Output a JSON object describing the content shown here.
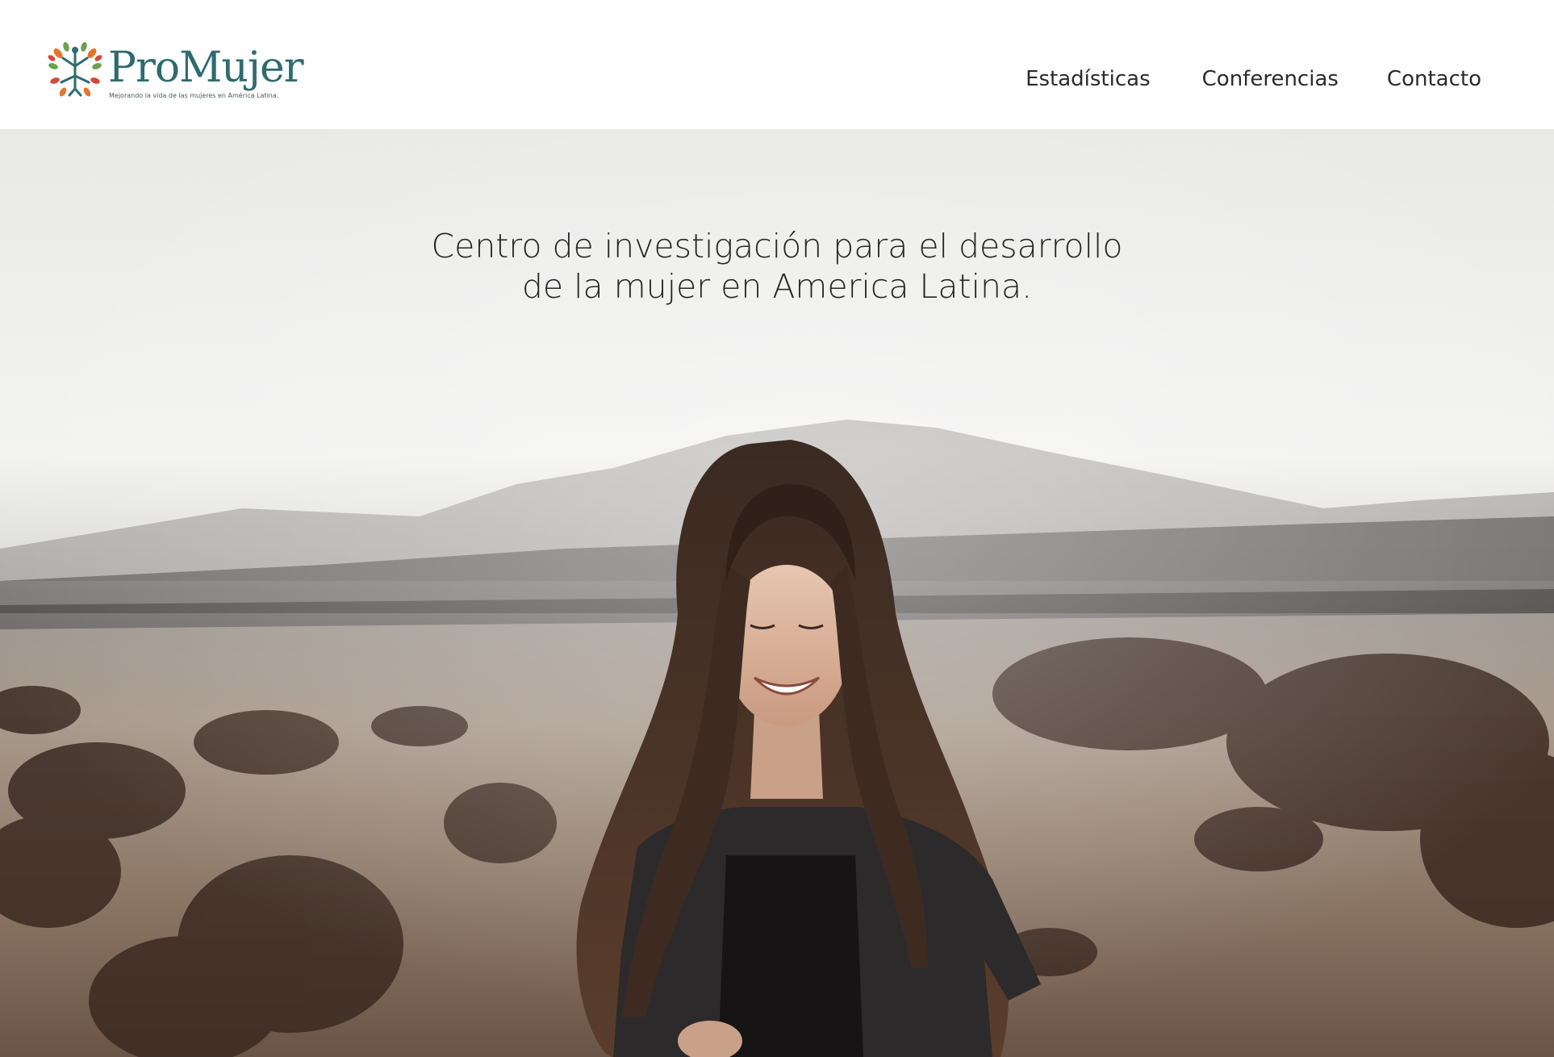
{
  "brand": {
    "name": "ProMujer",
    "tagline": "Mejorando la vida de las mujeres en América Latina.",
    "logo_icon": "tree-people-icon",
    "colors": {
      "text": "#2f6b6f",
      "leaf_orange": "#e4742b",
      "leaf_green": "#6da14a",
      "leaf_red": "#d24a3a"
    }
  },
  "nav": {
    "items": [
      {
        "label": "Estadísticas"
      },
      {
        "label": "Conferencias"
      },
      {
        "label": "Contacto"
      }
    ]
  },
  "hero": {
    "title_line1": "Centro de investigación para el desarrollo",
    "title_line2": "de la mujer en America Latina.",
    "image": "smiling-woman-desert-photo"
  }
}
